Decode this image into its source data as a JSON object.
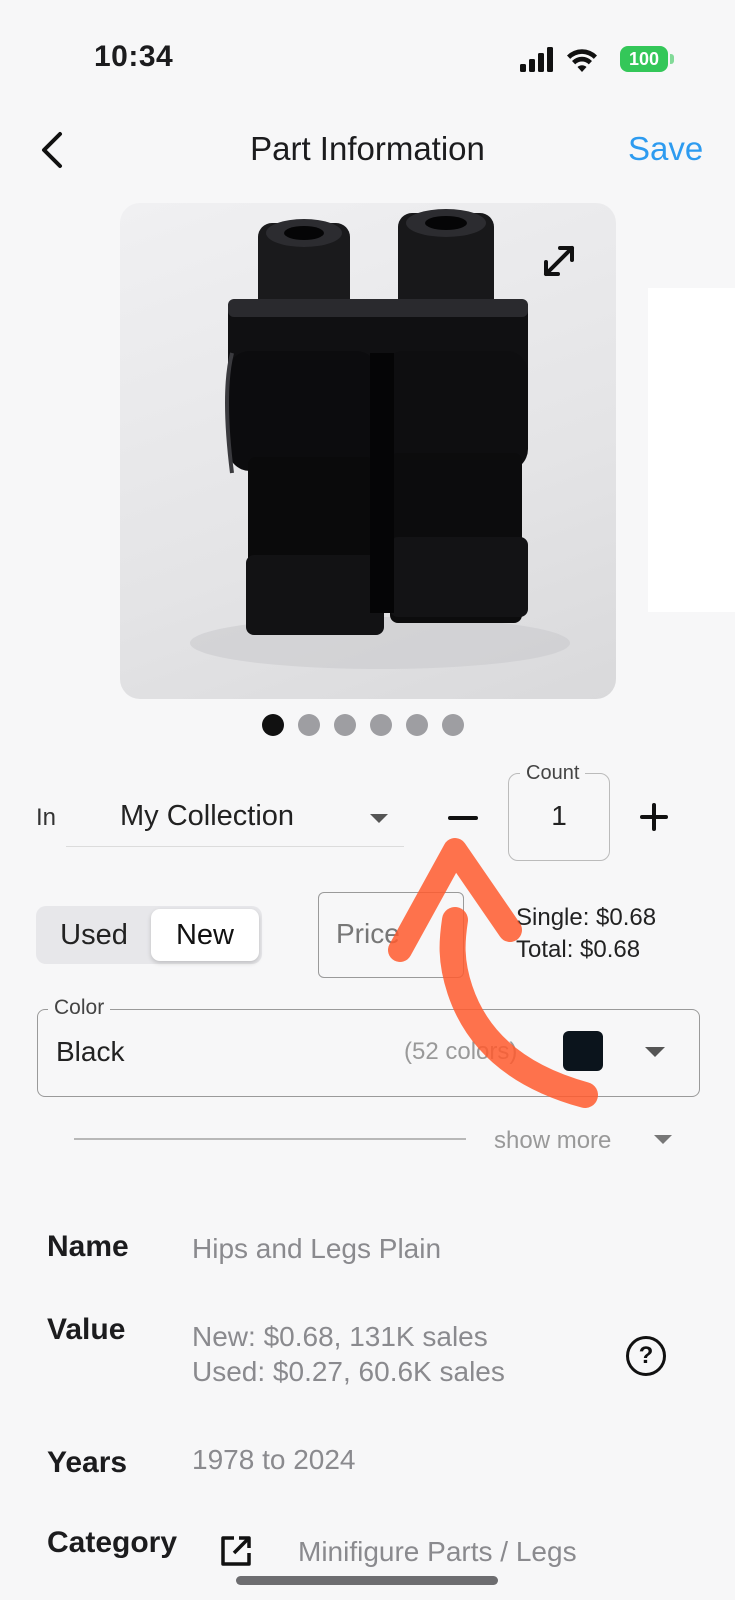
{
  "status_bar": {
    "time": "10:34",
    "battery": "100"
  },
  "nav": {
    "title": "Part Information",
    "save_label": "Save"
  },
  "gallery": {
    "page_count": 6,
    "active_index": 0
  },
  "collection": {
    "in_label": "In",
    "selected": "My Collection",
    "count_label": "Count",
    "count_value": "1"
  },
  "condition": {
    "options": [
      "Used",
      "New"
    ],
    "selected": "New",
    "price_placeholder": "Price",
    "single": "Single: $0.68",
    "total": "Total: $0.68"
  },
  "color_field": {
    "label": "Color",
    "value": "Black",
    "count": "(52 colors)",
    "swatch_color": "#0b141c"
  },
  "show_more_label": "show more",
  "details": {
    "name_label": "Name",
    "name_value": "Hips  and Legs Plain",
    "value_label": "Value",
    "value_new": "New: $0.68, 131K sales",
    "value_used": "Used: $0.27, 60.6K sales",
    "years_label": "Years",
    "years_value": "1978 to 2024",
    "category_label": "Category",
    "category_value": "Minifigure Parts / Legs"
  },
  "colors": {
    "accent": "#2d9bf0",
    "annotation_arrow": "#ff5a2e"
  },
  "icons": [
    "back-chevron-icon",
    "expand-icon",
    "help-icon",
    "external-link-icon",
    "signal-icon",
    "wifi-icon"
  ]
}
